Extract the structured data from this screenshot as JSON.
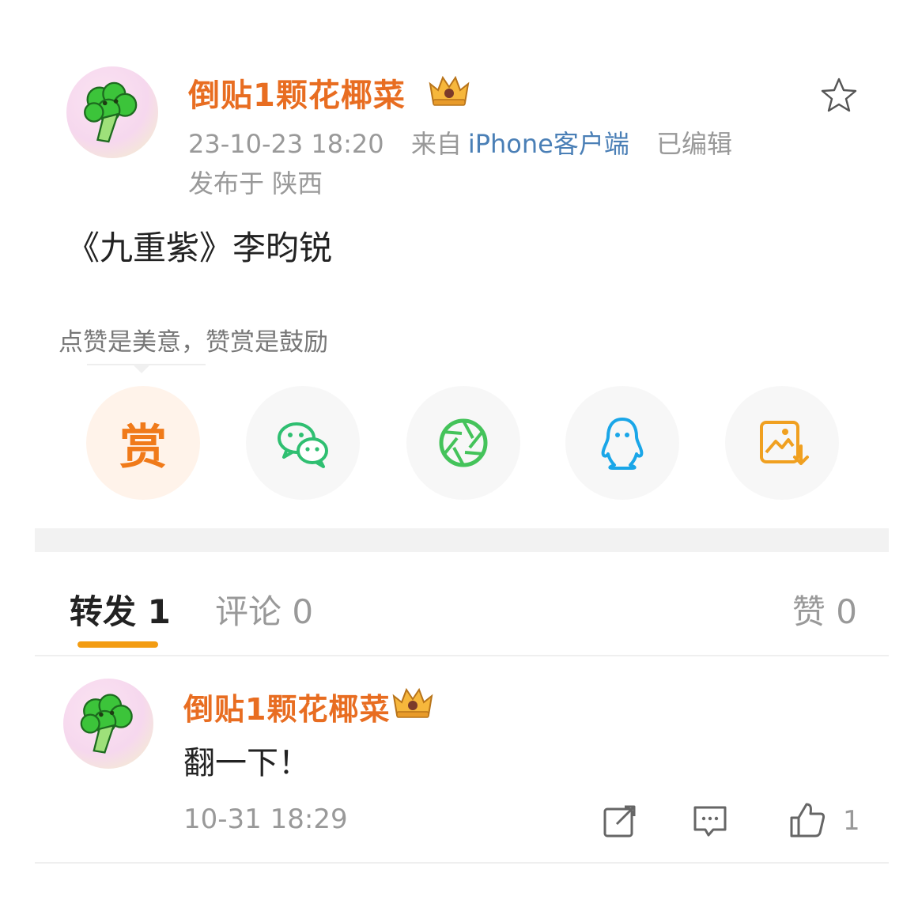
{
  "post": {
    "author": "倒贴1颗花椰菜",
    "timestamp": "23-10-23 18:20",
    "source_prefix": "来自",
    "client": "iPhone客户端",
    "edited": "已编辑",
    "location": "发布于 陕西",
    "text": "《九重紫》李昀锐",
    "avatar_icon": "broccoli-avatar",
    "crown_icon": "vip-crown-icon",
    "favorite_icon": "star-icon"
  },
  "reward": {
    "tip": "点赞是美意，赞赏是鼓励",
    "reward_label": "赏"
  },
  "share": [
    {
      "name": "wechat-icon",
      "color": "#2fbf71"
    },
    {
      "name": "moments-icon",
      "color": "#44c35a"
    },
    {
      "name": "qq-icon",
      "color": "#1aa6e8"
    },
    {
      "name": "save-image-icon",
      "color": "#f0a020"
    }
  ],
  "tabs": {
    "forward": "转发 1",
    "comment": "评论 0",
    "like": "赞 0"
  },
  "repost": {
    "author": "倒贴1颗花椰菜",
    "text": "翻一下！",
    "time": "10-31 18:29",
    "like_count": "1"
  },
  "colors": {
    "name": "#e86d21",
    "client": "#4a7fb6",
    "accent": "#f39c12"
  }
}
